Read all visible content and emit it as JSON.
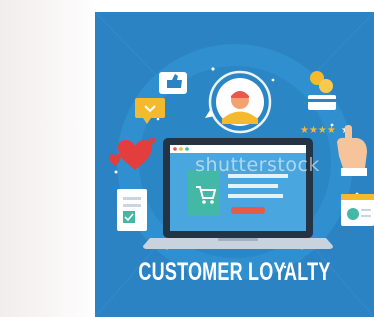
{
  "illustration": {
    "title": "CUSTOMER LOYALTY",
    "watermark": "shutterstock",
    "colors": {
      "panel": "#2b83c4",
      "ring": "#2f94d6",
      "screen": "#4aa6df",
      "heart": "#e43d3d",
      "gold": "#f5b92e",
      "green": "#43b8a6",
      "accent_red": "#e8584d"
    },
    "rating": {
      "stars_filled": 4,
      "stars_total": 5
    },
    "icons": [
      "user-avatar-icon",
      "thumbs-up-icon",
      "chat-bubble-icon",
      "coins-icon",
      "credit-card-icon",
      "hand-pointer-icon",
      "heart-icon",
      "document-icon",
      "profile-card-icon",
      "shopping-cart-icon",
      "laptop-icon"
    ]
  }
}
